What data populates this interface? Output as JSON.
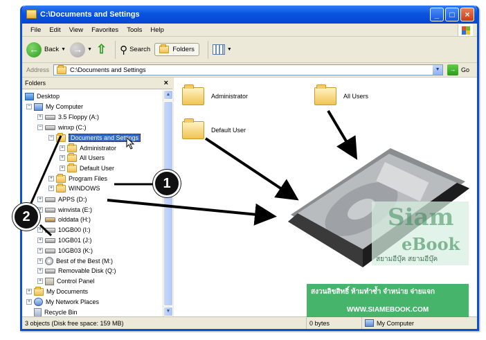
{
  "window": {
    "title": "C:\\Documents and Settings",
    "controls": [
      "_",
      "□",
      "×"
    ]
  },
  "menu": [
    "File",
    "Edit",
    "View",
    "Favorites",
    "Tools",
    "Help"
  ],
  "toolbar": {
    "back_label": "Back",
    "search_label": "Search",
    "folders_label": "Folders"
  },
  "address": {
    "label": "Address",
    "value": "C:\\Documents and Settings",
    "go_label": "Go"
  },
  "folders_pane": {
    "header": "Folders",
    "close": "×"
  },
  "tree": [
    {
      "label": "Desktop",
      "icon": "desktop-icon"
    },
    {
      "label": "My Computer",
      "icon": "computer-icon"
    },
    {
      "label": "3.5 Floppy (A:)",
      "icon": "floppy-icon"
    },
    {
      "label": "winxp (C:)",
      "icon": "drive-icon"
    },
    {
      "label": "Documents and Settings",
      "icon": "folder-icon",
      "selected": true
    },
    {
      "label": "Administrator",
      "icon": "folder-icon"
    },
    {
      "label": "All Users",
      "icon": "folder-icon"
    },
    {
      "label": "Default User",
      "icon": "folder-icon"
    },
    {
      "label": "Program Files",
      "icon": "folder-icon"
    },
    {
      "label": "WINDOWS",
      "icon": "folder-icon"
    },
    {
      "label": "APPS (D:)",
      "icon": "drive-icon"
    },
    {
      "label": "winvista (E:)",
      "icon": "drive-icon"
    },
    {
      "label": "olddata (H:)",
      "icon": "drive-icon"
    },
    {
      "label": "10GB00 (I:)",
      "icon": "drive-icon"
    },
    {
      "label": "10GB01 (J:)",
      "icon": "drive-icon"
    },
    {
      "label": "10GB03 (K:)",
      "icon": "drive-icon"
    },
    {
      "label": "Best of the Best (M:)",
      "icon": "cd-icon"
    },
    {
      "label": "Removable Disk (Q:)",
      "icon": "removable-disk-icon"
    },
    {
      "label": "Control Panel",
      "icon": "control-panel-icon"
    },
    {
      "label": "My Documents",
      "icon": "documents-icon"
    },
    {
      "label": "My Network Places",
      "icon": "network-icon"
    },
    {
      "label": "Recycle Bin",
      "icon": "recycle-bin-icon"
    }
  ],
  "files": [
    {
      "label": "Administrator"
    },
    {
      "label": "All Users"
    },
    {
      "label": "Default User"
    }
  ],
  "status": {
    "objects": "3 objects (Disk free space: 159 MB)",
    "size": "0 bytes",
    "location": "My Computer"
  },
  "callouts": [
    "1",
    "2"
  ],
  "watermark": {
    "brand1": "Siam",
    "brand2": "eBook",
    "thai_name": "สยามอีบุ๊ค สยามอีบุ๊ค",
    "banner": "สงวนลิขสิทธิ์ ห้ามทำซ้ำ จำหน่าย จ่ายแจก",
    "url": "WWW.SIAMEBOOK.COM"
  },
  "colors": {
    "titlebar": "#0a54e0",
    "selection": "#316ac5",
    "watermark_green": "#2eaa58"
  }
}
